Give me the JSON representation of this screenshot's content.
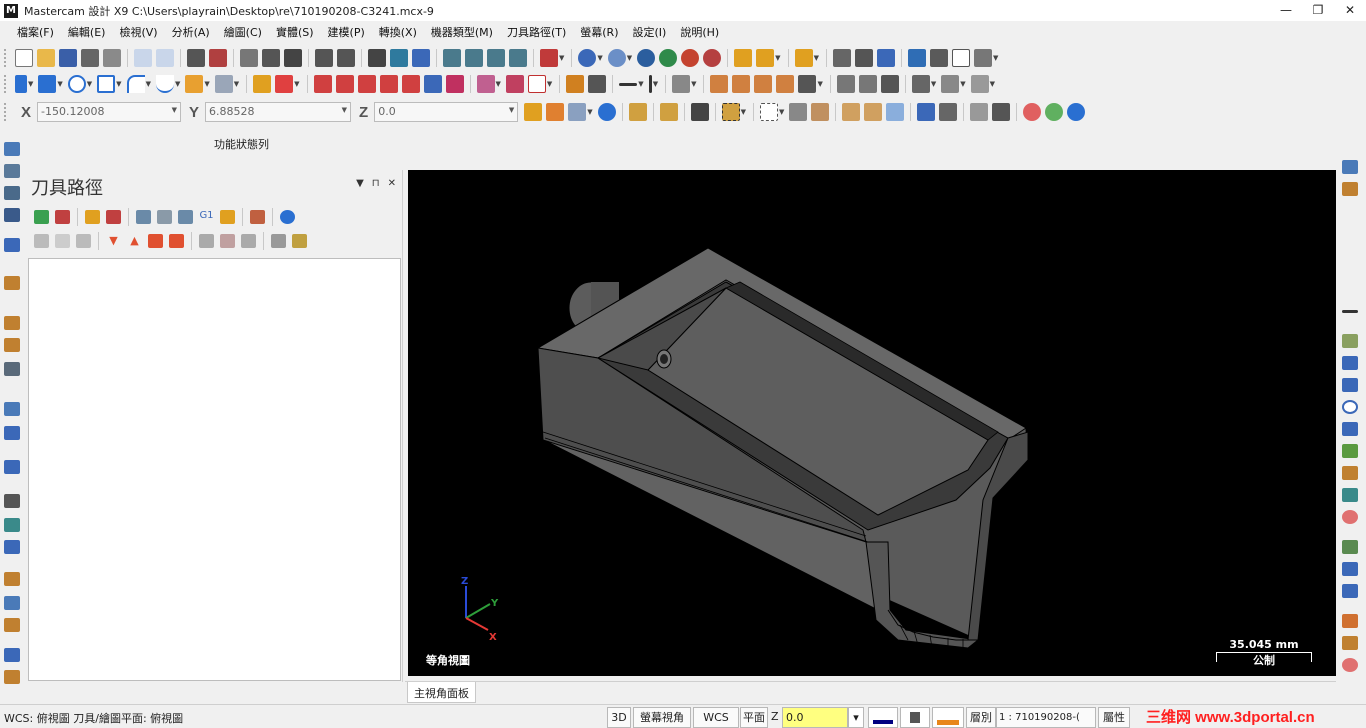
{
  "app": {
    "title": "Mastercam 設計 X9  C:\\Users\\playrain\\Desktop\\re\\710190208-C3241.mcx-9",
    "window_buttons": [
      "—",
      "❐",
      "✕"
    ]
  },
  "menu": [
    "檔案(F)",
    "編輯(E)",
    "檢視(V)",
    "分析(A)",
    "繪圖(C)",
    "實體(S)",
    "建模(P)",
    "轉換(X)",
    "機器類型(M)",
    "刀具路徑(T)",
    "螢幕(R)",
    "設定(I)",
    "說明(H)"
  ],
  "coords": {
    "x_label": "X",
    "x_value": "-150.12008",
    "y_label": "Y",
    "y_value": "6.88528",
    "z_label": "Z",
    "z_value": "0.0"
  },
  "function_status_label": "功能狀態列",
  "toolpath_panel": {
    "title": "刀具路徑",
    "pin": "▼",
    "dock": "⊓",
    "close": "✕"
  },
  "viewport": {
    "view_name": "等角視圖",
    "scale_value": "35.045 mm",
    "scale_unit": "公制",
    "triad": {
      "z": "Z",
      "y": "Y",
      "x": "X"
    },
    "background": "#000000",
    "model_color": "#5a5a5a",
    "triad_colors": {
      "x": "#e53935",
      "y": "#2e9e3a",
      "z": "#2a4bd7"
    }
  },
  "view_tab": "主視角面板",
  "status": {
    "wcs_info": "WCS: 俯視圖  刀具/繪圖平面: 俯視圖",
    "btn_3d": "3D",
    "btn_screen_view": "螢幕視角",
    "btn_wcs": "WCS",
    "btn_plane": "平面",
    "z_label": "Z",
    "z_value": "0.0",
    "layer_label": "層別",
    "layer_value": "1 : 710190208-(",
    "attr_label": "屬性",
    "watermark": "三维网 www.3dportal.cn"
  },
  "colors": {
    "accent_blue": "#2a6fd1",
    "accent_orange": "#e8861a",
    "z_field": "#ffff80"
  }
}
